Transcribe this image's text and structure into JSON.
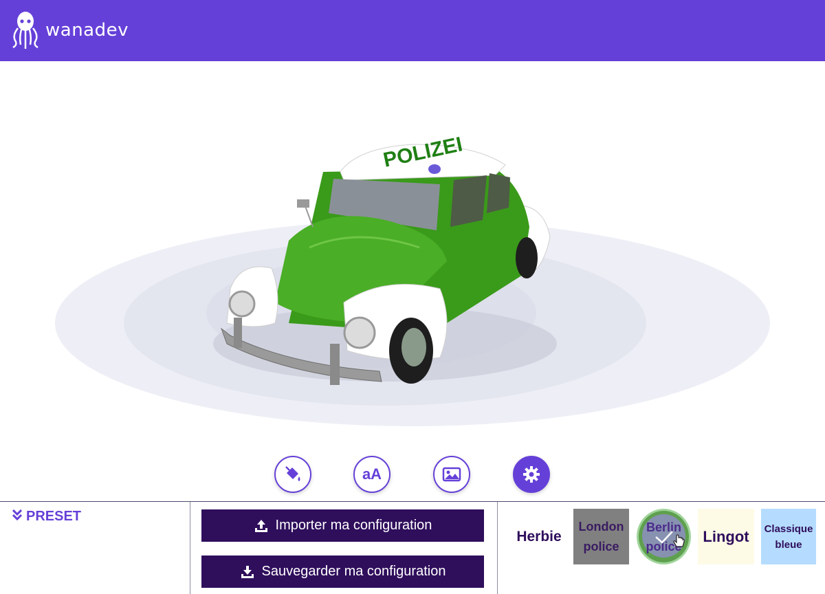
{
  "header": {
    "brand": "wanadev",
    "background_color": "#6540d8",
    "logo_icon": "octopus-logo-icon"
  },
  "viewport": {
    "content": "3d-car-model",
    "roof_text": "POLIZEI",
    "car_body_color": "#3f9b1f"
  },
  "toolbar": {
    "items": [
      {
        "icon": "paint-bucket-icon",
        "active": false
      },
      {
        "icon": "text-aa-icon",
        "label": "aA",
        "active": false
      },
      {
        "icon": "image-icon",
        "active": false
      },
      {
        "icon": "gear-icon",
        "active": true
      }
    ]
  },
  "preset": {
    "label": "PRESET",
    "icon": "double-chevron-down-icon"
  },
  "actions": {
    "import_label": "Importer ma configuration",
    "save_label": "Sauvegarder ma configuration"
  },
  "presets": {
    "herbie": "Herbie",
    "london_line1": "London",
    "london_line2": "police",
    "berlin_line1": "Berlin",
    "berlin_line2": "police",
    "lingot": "Lingot",
    "classique_line1": "Classique",
    "classique_line2": "bleue",
    "selected": "berlin"
  },
  "colors": {
    "accent": "#6540d8",
    "dark_button": "#2f0e5c"
  }
}
